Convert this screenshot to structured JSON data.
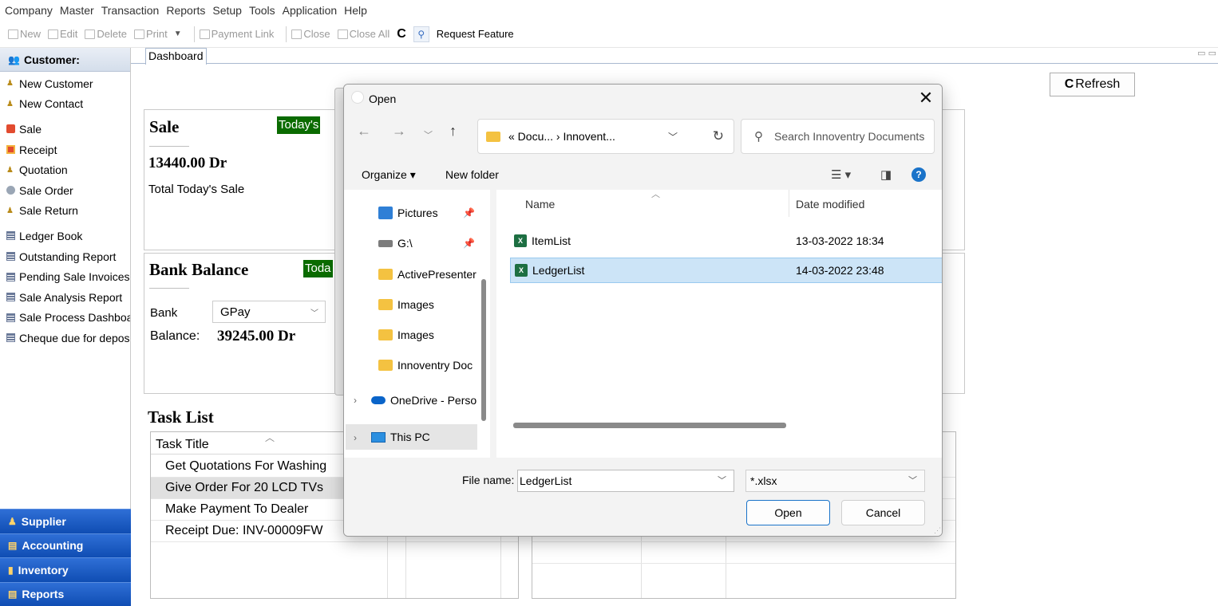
{
  "menu": [
    "Company",
    "Master",
    "Transaction",
    "Reports",
    "Setup",
    "Tools",
    "Application",
    "Help"
  ],
  "toolbar": {
    "new": "New",
    "edit": "Edit",
    "delete": "Delete",
    "print": "Print",
    "payment_link": "Payment Link",
    "close": "Close",
    "close_all": "Close All",
    "request_feature": "Request Feature"
  },
  "sidebar": {
    "header": "Customer:",
    "items": [
      "New Customer",
      "New Contact",
      "Sale",
      "Receipt",
      "Quotation",
      "Sale Order",
      "Sale Return",
      "Ledger Book",
      "Outstanding Report",
      "Pending Sale Invoices",
      "Sale Analysis Report",
      "Sale Process Dashboard",
      "Cheque due for deposit"
    ],
    "categories": [
      "Supplier",
      "Accounting",
      "Inventory",
      "Reports"
    ]
  },
  "tab": {
    "label": "Dashboard"
  },
  "dashboard": {
    "refresh": "Refresh",
    "sale": {
      "title": "Sale",
      "badge": "Today's",
      "value": "13440.00 Dr",
      "label": "Total Today's Sale"
    },
    "bank": {
      "title": "Bank Balance",
      "badge": "Toda",
      "bank_label": "Bank",
      "bank_value": "GPay",
      "balance_label": "Balance:",
      "balance_value": "39245.00 Dr"
    },
    "tasks": {
      "title": "Task List",
      "column": "Task Title",
      "rows": [
        "Get Quotations For Washing",
        "Give Order For 20 LCD TVs",
        "Make Payment To Dealer",
        "Receipt Due: INV-00009FW"
      ]
    }
  },
  "dialog": {
    "title": "Open",
    "address": "« Docu...  ›  Innovent...",
    "search_placeholder": "Search Innoventry Documents",
    "organize": "Organize ▾",
    "new_folder": "New folder",
    "nav_items": [
      "Pictures",
      "G:\\",
      "ActivePresenter",
      "Images",
      "Images",
      "Innoventry Doc",
      "OneDrive - Perso",
      "This PC"
    ],
    "columns": {
      "name": "Name",
      "date": "Date modified"
    },
    "files": [
      {
        "name": "ItemList",
        "date": "13-03-2022 18:34"
      },
      {
        "name": "LedgerList",
        "date": "14-03-2022 23:48"
      }
    ],
    "file_name_label": "File name:",
    "file_name_value": "LedgerList",
    "file_type": "*.xlsx",
    "open_button": "Open",
    "cancel_button": "Cancel"
  },
  "colors": {
    "sidebar_category": "#1558c4",
    "badge_green": "#0a6b00",
    "selection": "#cce4f7",
    "accent": "#1a73c9"
  }
}
